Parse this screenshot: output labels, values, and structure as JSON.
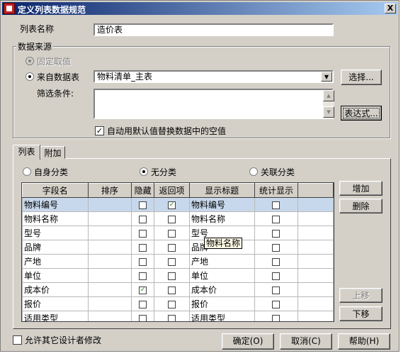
{
  "window": {
    "title": "定义列表数据规范",
    "close_label": "X"
  },
  "list_name": {
    "label": "列表名称",
    "value": "造价表"
  },
  "data_source": {
    "group_label": "数据来源",
    "fixed_value_label": "固定取值",
    "from_table_label": "来自数据表",
    "table_value": "物料清单_主表",
    "select_button": "选择...",
    "filter_label": "筛选条件:",
    "filter_value": "",
    "expression_button": "表达式...",
    "auto_default_label": "自动用默认值替换数据中的空值"
  },
  "tabs": [
    {
      "label": "列表"
    },
    {
      "label": "附加"
    }
  ],
  "classification": {
    "self": "自身分类",
    "none": "无分类",
    "related": "关联分类"
  },
  "grid": {
    "headers": [
      "字段名",
      "排序",
      "隐藏",
      "返回项",
      "显示标题",
      "统计显示"
    ],
    "rows": [
      {
        "field": "物料编号",
        "sort": "",
        "hidden": false,
        "ret": true,
        "title": "物料编号",
        "stat": false
      },
      {
        "field": "物料名称",
        "sort": "",
        "hidden": false,
        "ret": false,
        "title": "物料名称",
        "stat": false
      },
      {
        "field": "型号",
        "sort": "",
        "hidden": false,
        "ret": false,
        "title": "型号",
        "stat": false
      },
      {
        "field": "品牌",
        "sort": "",
        "hidden": false,
        "ret": false,
        "title": "品牌",
        "stat": false
      },
      {
        "field": "产地",
        "sort": "",
        "hidden": false,
        "ret": false,
        "title": "产地",
        "stat": false
      },
      {
        "field": "单位",
        "sort": "",
        "hidden": false,
        "ret": false,
        "title": "单位",
        "stat": false
      },
      {
        "field": "成本价",
        "sort": "",
        "hidden": true,
        "ret": false,
        "title": "成本价",
        "stat": false
      },
      {
        "field": "报价",
        "sort": "",
        "hidden": false,
        "ret": false,
        "title": "报价",
        "stat": false
      },
      {
        "field": "适用类型",
        "sort": "",
        "hidden": false,
        "ret": false,
        "title": "适用类型",
        "stat": false
      }
    ],
    "tooltip": "物料名称"
  },
  "side_buttons": {
    "add": "增加",
    "delete": "删除",
    "move_up": "上移",
    "move_down": "下移"
  },
  "footer": {
    "allow_others_label": "允许其它设计者修改",
    "ok": "确定(O)",
    "cancel": "取消(C)",
    "help": "帮助(H)"
  }
}
